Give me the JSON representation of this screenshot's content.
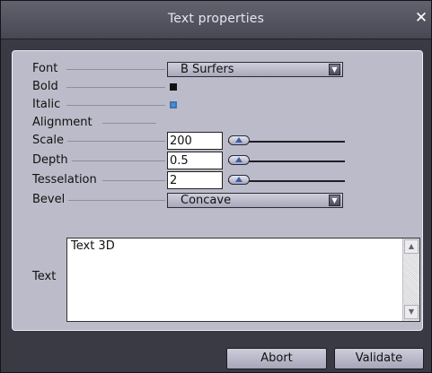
{
  "dialog": {
    "title": "Text properties",
    "close_glyph": "✕"
  },
  "fields": {
    "font": {
      "label": "Font",
      "value": "B Surfers"
    },
    "bold": {
      "label": "Bold",
      "checked": false
    },
    "italic": {
      "label": "Italic",
      "checked": true
    },
    "alignment": {
      "label": "Alignment"
    },
    "scale": {
      "label": "Scale",
      "value": "200"
    },
    "depth": {
      "label": "Depth",
      "value": "0.5"
    },
    "tesselation": {
      "label": "Tesselation",
      "value": "2"
    },
    "bevel": {
      "label": "Bevel",
      "value": "Concave"
    },
    "text": {
      "label": "Text",
      "value": "Text 3D"
    }
  },
  "icons": {
    "dropdown": "chevron-down-icon",
    "slider_thumb": "slider-thumb-icon",
    "scroll_up": "arrow-up-icon",
    "scroll_down": "arrow-down-icon"
  },
  "glyphs": {
    "dropdown": "▼",
    "up": "▲",
    "down": "▼"
  },
  "buttons": {
    "abort": "Abort",
    "validate": "Validate"
  }
}
